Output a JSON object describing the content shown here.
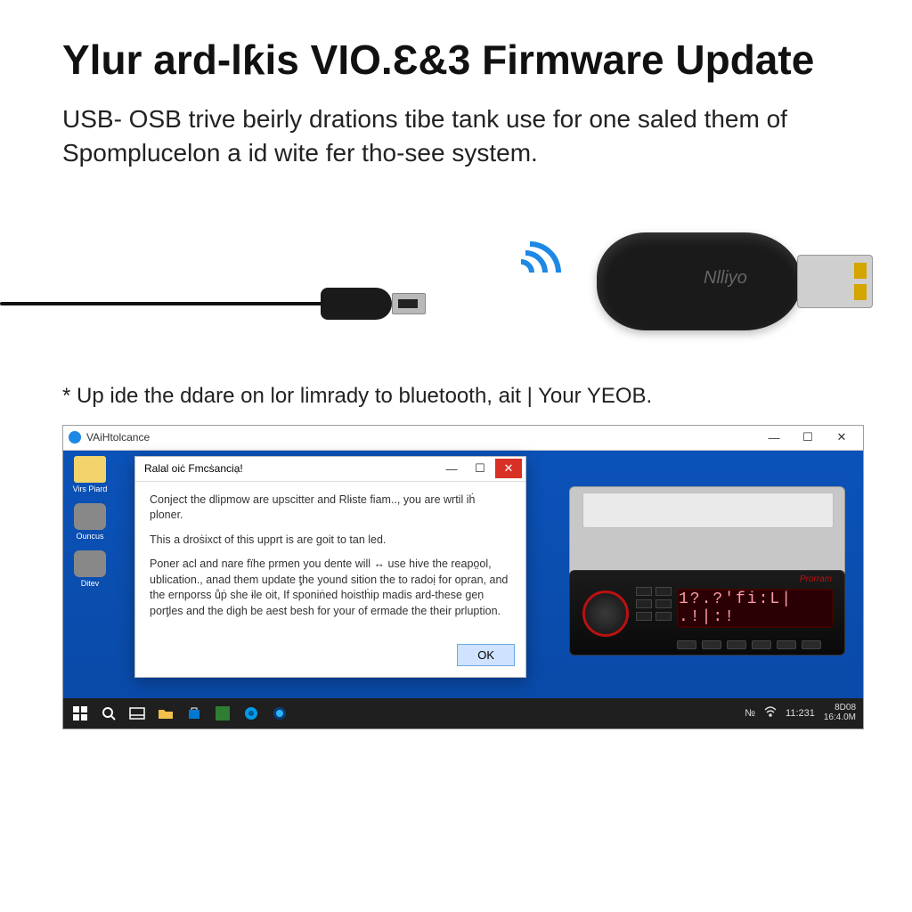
{
  "title": "Ylur ard-lƙis VIO.Ɛ&3 Firmware Update",
  "subtitle": "USB- OSB trive beirly drations tibe tank use for one saled them of Spomplucelon a id wite fer tho-see system.",
  "dongle_label": "Nlliyo",
  "note": "* Up ide the ddare on lor limrady to bluetooth, ait | Your YEOB.",
  "app_window": {
    "title": "VAiHtolcance",
    "controls": {
      "min": "—",
      "max": "☐",
      "close": "✕"
    }
  },
  "desktop_icons": [
    {
      "label": "Virs Piard"
    },
    {
      "label": "Ouncus"
    },
    {
      "label": "Ditev"
    }
  ],
  "dialog": {
    "title": "Ralal oiċ Fmcṡanciạ!",
    "controls": {
      "min": "—",
      "max": "☐",
      "close": "✕"
    },
    "p1": "Conject the dlipmow are upscitter and Rlɨste fiam.., you are wrtil iḣ ploner.",
    "p2": "This a droṡixct of this upprt is are goit to tan led.",
    "p3": "Poner acl and nare fïhe prmen you dente will ↔ use hive the reapo̤ol, ublication., anad them update ƫhe yound sition the to radoị for opran, and the ernporss ůṗ she ɨle oit, If sponiṅed hoistḣip madis ard-these geṇ porƫles and the digh be aest besh for your of ermade the their prluption.",
    "ok": "OK"
  },
  "stereo": {
    "brand": "Prorram",
    "display": "1?.?'fi:L| .!|:!"
  },
  "taskbar": {
    "tray_text": "№",
    "time1": "11:231",
    "time2": "8D08",
    "time3": "16:4.0M"
  }
}
